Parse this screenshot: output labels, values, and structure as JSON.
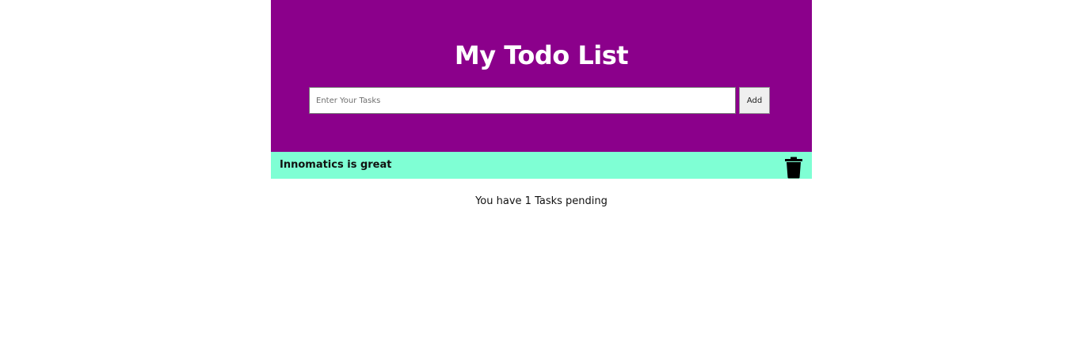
{
  "header": {
    "title": "My Todo List",
    "input_placeholder": "Enter Your Tasks",
    "input_value": "",
    "add_label": "Add"
  },
  "tasks": [
    {
      "text": "Innomatics is great",
      "icon": "trash-icon"
    }
  ],
  "footer": {
    "pending_prefix": "You have ",
    "pending_count": "1",
    "pending_suffix": " Tasks pending"
  },
  "colors": {
    "header_bg": "#8b008b",
    "task_bg": "#7fffd4"
  }
}
